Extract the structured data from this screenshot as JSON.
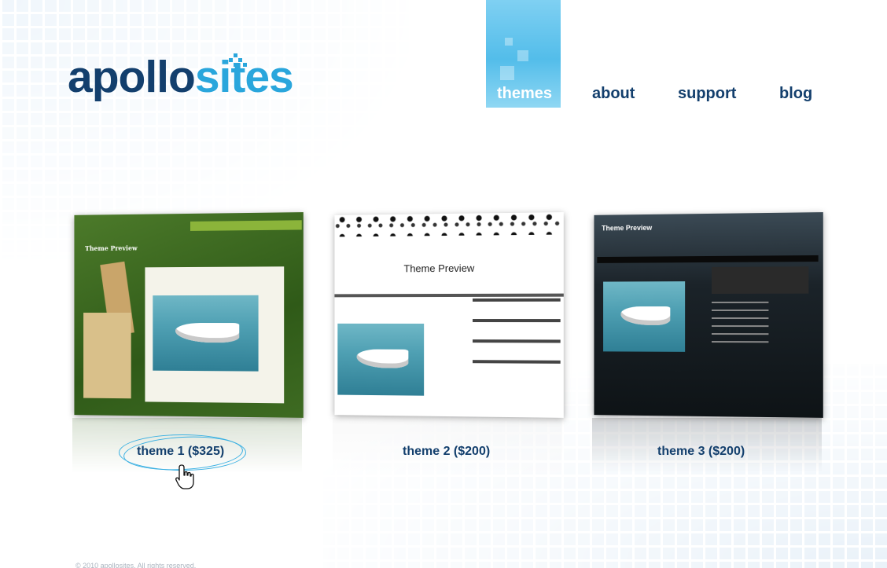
{
  "logo": {
    "part1": "apollo",
    "part2": "sites"
  },
  "nav": {
    "items": [
      {
        "label": "themes",
        "active": true
      },
      {
        "label": "about"
      },
      {
        "label": "support"
      },
      {
        "label": "blog"
      }
    ]
  },
  "themes": [
    {
      "caption": "theme 1 ($325)",
      "preview_title": "Theme Preview"
    },
    {
      "caption": "theme 2 ($200)",
      "preview_title": "Theme Preview"
    },
    {
      "caption": "theme 3 ($200)",
      "preview_title": "Theme Preview"
    }
  ],
  "colors": {
    "brand_dark": "#133f6d",
    "brand_light": "#2aa6dc",
    "nav_active_bg": "#53bdea"
  },
  "footer": {
    "text": "© 2010 apollosites. All rights reserved."
  }
}
